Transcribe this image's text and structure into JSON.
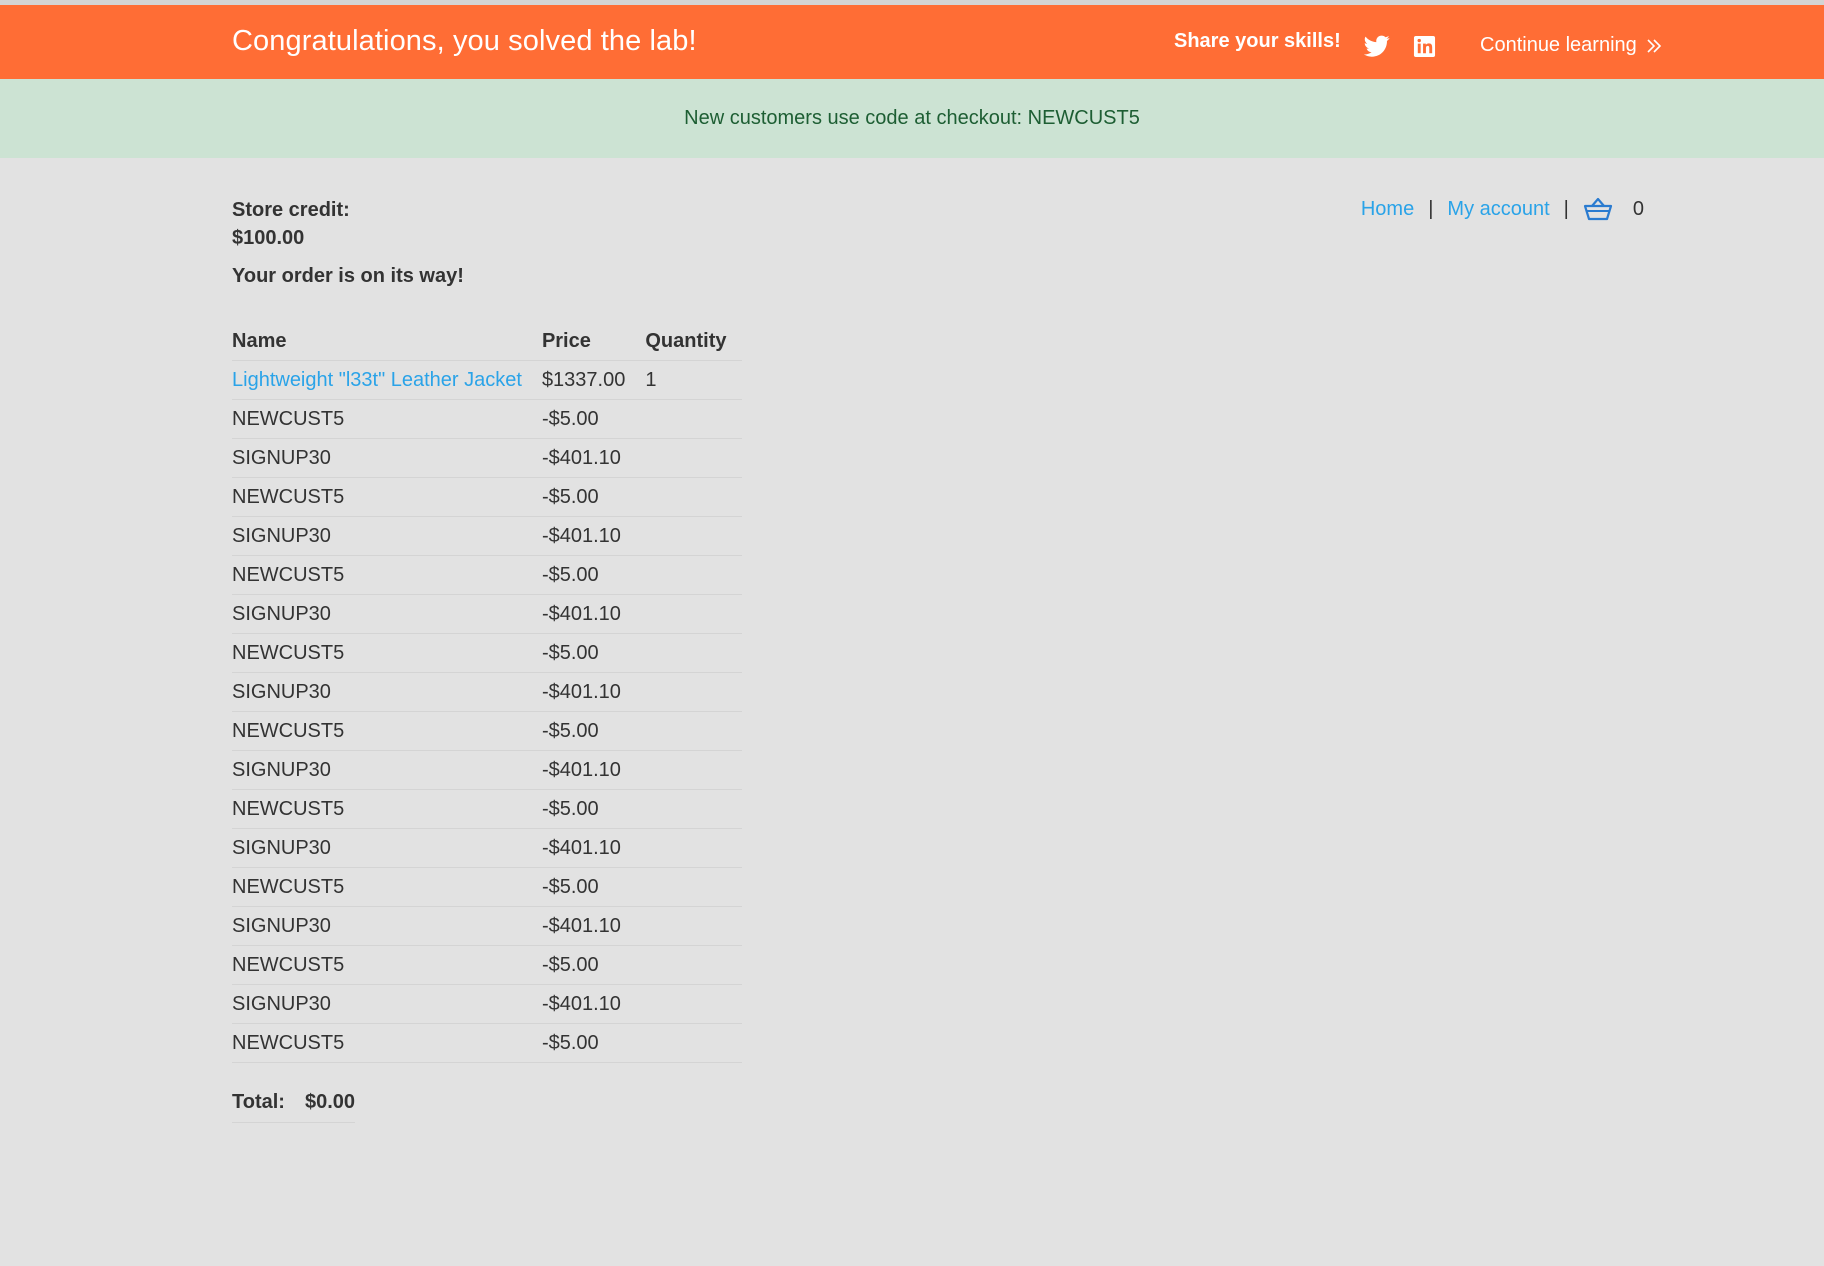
{
  "colors": {
    "banner_bg": "#ff6d35",
    "notice_bg": "#cce3d3",
    "notice_text": "#1d5e33",
    "link": "#2aa3e8",
    "page_bg": "#e2e2e2"
  },
  "banner": {
    "title": "Congratulations, you solved the lab!",
    "share_label": "Share your skills!",
    "continue_label": "Continue learning",
    "icons": [
      "twitter-icon",
      "linkedin-icon",
      "chevron-double-right-icon"
    ]
  },
  "notice": {
    "text": "New customers use code at checkout: NEWCUST5"
  },
  "account": {
    "store_credit_label": "Store credit:",
    "store_credit_value": "$100.00"
  },
  "nav": {
    "home": "Home",
    "separator": "|",
    "my_account": "My account",
    "cart_count": "0",
    "cart_icon": "basket-icon"
  },
  "order": {
    "message": "Your order is on its way!",
    "columns": [
      "Name",
      "Price",
      "Quantity"
    ],
    "rows": [
      {
        "name": "Lightweight \"l33t\" Leather Jacket",
        "price": "$1337.00",
        "quantity": "1"
      },
      {
        "name": "NEWCUST5",
        "price": "-$5.00",
        "quantity": ""
      },
      {
        "name": "SIGNUP30",
        "price": "-$401.10",
        "quantity": ""
      },
      {
        "name": "NEWCUST5",
        "price": "-$5.00",
        "quantity": ""
      },
      {
        "name": "SIGNUP30",
        "price": "-$401.10",
        "quantity": ""
      },
      {
        "name": "NEWCUST5",
        "price": "-$5.00",
        "quantity": ""
      },
      {
        "name": "SIGNUP30",
        "price": "-$401.10",
        "quantity": ""
      },
      {
        "name": "NEWCUST5",
        "price": "-$5.00",
        "quantity": ""
      },
      {
        "name": "SIGNUP30",
        "price": "-$401.10",
        "quantity": ""
      },
      {
        "name": "NEWCUST5",
        "price": "-$5.00",
        "quantity": ""
      },
      {
        "name": "SIGNUP30",
        "price": "-$401.10",
        "quantity": ""
      },
      {
        "name": "NEWCUST5",
        "price": "-$5.00",
        "quantity": ""
      },
      {
        "name": "SIGNUP30",
        "price": "-$401.10",
        "quantity": ""
      },
      {
        "name": "NEWCUST5",
        "price": "-$5.00",
        "quantity": ""
      },
      {
        "name": "SIGNUP30",
        "price": "-$401.10",
        "quantity": ""
      },
      {
        "name": "NEWCUST5",
        "price": "-$5.00",
        "quantity": ""
      },
      {
        "name": "SIGNUP30",
        "price": "-$401.10",
        "quantity": ""
      },
      {
        "name": "NEWCUST5",
        "price": "-$5.00",
        "quantity": ""
      }
    ],
    "total_label": "Total:",
    "total_value": "$0.00"
  }
}
